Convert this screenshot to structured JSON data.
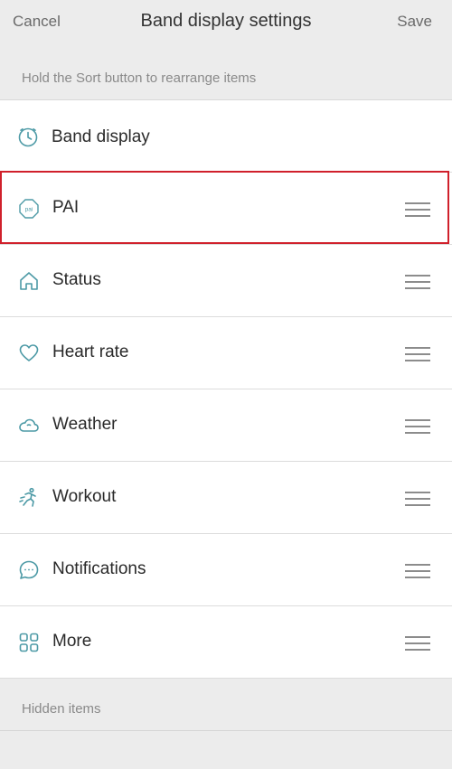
{
  "nav": {
    "cancel_label": "Cancel",
    "title": "Band display settings",
    "save_label": "Save"
  },
  "hint": "Hold the Sort button to rearrange items",
  "items": [
    {
      "label": "Band display",
      "icon": "clock-icon",
      "sortable": false
    },
    {
      "label": "PAI",
      "icon": "pai-icon",
      "sortable": true
    },
    {
      "label": "Status",
      "icon": "home-icon",
      "sortable": true
    },
    {
      "label": "Heart rate",
      "icon": "heart-icon",
      "sortable": true
    },
    {
      "label": "Weather",
      "icon": "cloud-icon",
      "sortable": true
    },
    {
      "label": "Workout",
      "icon": "running-icon",
      "sortable": true
    },
    {
      "label": "Notifications",
      "icon": "chat-bubble-icon",
      "sortable": true
    },
    {
      "label": "More",
      "icon": "grid-icon",
      "sortable": true
    }
  ],
  "hidden_items_label": "Hidden items",
  "colors": {
    "accent": "#4d9aa6",
    "highlight": "#d0202b",
    "background": "#ececec"
  }
}
